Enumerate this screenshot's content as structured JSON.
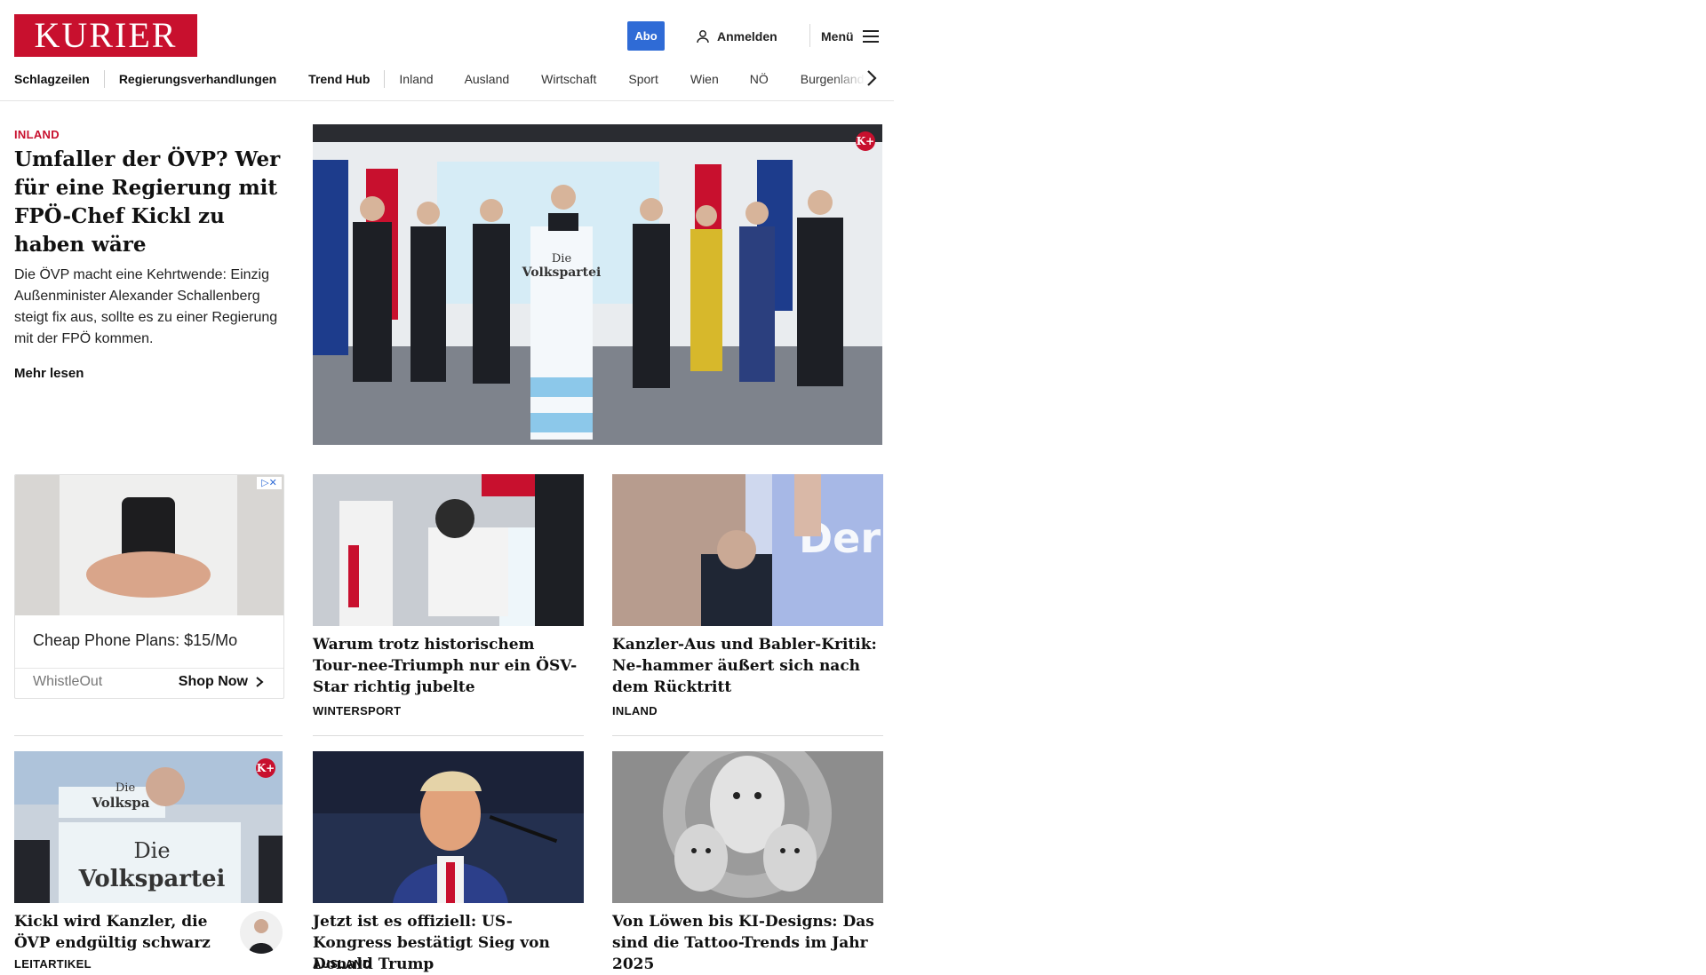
{
  "header": {
    "logo": "KURIER",
    "abo_label": "Abo",
    "login_label": "Anmelden",
    "menu_label": "Menü"
  },
  "nav": {
    "items": [
      "Schlagzeilen",
      "Regierungsverhandlungen",
      "Trend Hub",
      "Inland",
      "Ausland",
      "Wirtschaft",
      "Sport",
      "Wien",
      "NÖ",
      "Burgenland"
    ]
  },
  "lead": {
    "kicker": "INLAND",
    "title": "Umfaller der ÖVP? Wer für eine Regierung mit FPÖ-Chef Kickl zu haben wäre",
    "teaser": "Die ÖVP macht eine Kehrtwende: Einzig Außenminister Alexander Schallenberg steigt fix aus, sollte es zu einer Regierung mit der FPÖ kommen.",
    "more": "Mehr lesen",
    "badge": "K+",
    "image_text_1": "Die",
    "image_text_2": "Volkspartei"
  },
  "ad": {
    "title": "Cheap Phone Plans: $15/Mo",
    "source": "WhistleOut",
    "cta": "Shop Now"
  },
  "cards": [
    {
      "title": "Warum trotz historischem Tour-nee-Triumph nur ein ÖSV-Star richtig jubelte",
      "kicker": "WINTERSPORT"
    },
    {
      "title": "Kanzler-Aus und Babler-Kritik: Ne-hammer äußert sich nach dem Rücktritt",
      "kicker": "INLAND",
      "image_text": "Der Verd"
    },
    {
      "title": "Kickl wird Kanzler, die ÖVP endgültig schwarz",
      "kicker": "LEITARTIKEL",
      "badge": "K+",
      "image_text_1": "Die",
      "image_text_2": "Volkspartei"
    },
    {
      "title": "Jetzt ist es offiziell: US-Kongress bestätigt Sieg von Donald Trump",
      "kicker": "AUSLAND"
    },
    {
      "title": "Von Löwen bis KI-Designs: Das sind die Tattoo-Trends im Jahr 2025",
      "kicker": ""
    }
  ]
}
